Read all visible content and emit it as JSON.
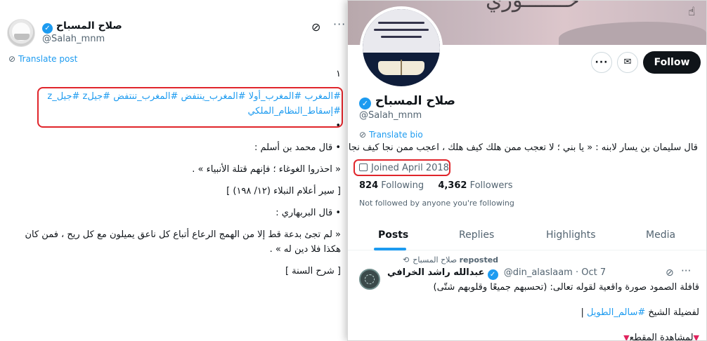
{
  "post": {
    "author_name": "صلاح المسباح",
    "author_handle": "@Salah_mnm",
    "translate_label": "Translate post",
    "hashtags_line1": "#المغرب #المغرب_أولا #المغرب_ينتفض #المغرب_تنتفض #جيلz #جيل_z",
    "hashtags_line2": "#إسقاط_النظام_الملكي",
    "lines": [
      "١",
      "•",
      "• قال محمد بن أسلم :",
      "« احذروا الغوغاء ؛ فإنهم قتلة الأنبياء » .",
      "[ سير أعلام النبلاء (١٢/ ١٩٨) ]",
      "• قال البربهاري :",
      "« لم تجئ بدعة قط إلا من الهمج الرعاع أتباع كل ناعق يميلون مع كل ريح ، فمن كان",
      "هكذا فلا دين له » .",
      "[ شرح السنة ]"
    ]
  },
  "profile": {
    "follow_label": "Follow",
    "name": "صلاح المسباح",
    "handle": "@Salah_mnm",
    "translate_bio_label": "Translate bio",
    "bio": "قال سليمان بن يسار لابنه : « يا بني ؛ لا تعجب ممن هلك كيف هلك ، اعجب ممن نجا كيف نجا ! » .",
    "joined": "Joined April 2018",
    "following_count": "824",
    "following_label": "Following",
    "followers_count": "4,362",
    "followers_label": "Followers",
    "not_followed_text": "Not followed by anyone you're following",
    "tabs": [
      "Posts",
      "Replies",
      "Highlights",
      "Media"
    ],
    "active_tab": "Posts"
  },
  "repost": {
    "reposter": "صلاح المسباح",
    "reposted_label": "reposted",
    "author_name": "عبدالله راشد الخرافي",
    "author_handle_date": "@din_alaslaam · Oct 7",
    "line1": "قافلة الصمود صورة واقعية لقوله تعالى: (تحسبهم جميعًا وقلوبهم شتّى)",
    "line2_prefix": "لفضيلة الشيخ ",
    "line2_link": "#سالم_الطويل",
    "line2_suffix": " |",
    "line3": "لمشاهدة المقطع"
  },
  "icons": {
    "verified": "verified-badge-icon",
    "grok": "grok-icon",
    "more": "more-dots-icon",
    "message": "envelope-icon",
    "calendar": "calendar-icon",
    "repost": "repost-icon",
    "cursor": "hand-pointer-icon"
  },
  "colors": {
    "accent": "#1d9bf0",
    "highlight_box": "#e0252b",
    "text": "#0f1419",
    "muted": "#536471"
  }
}
